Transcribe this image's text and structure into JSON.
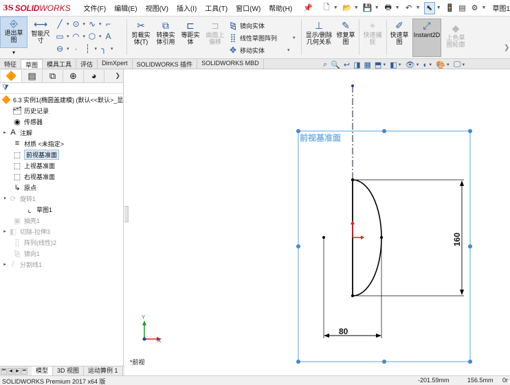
{
  "app": {
    "logo_ds": "3S",
    "logo_solid": "SOLID",
    "logo_works": "WORKS",
    "document_title": "草图1"
  },
  "menu": {
    "items": [
      {
        "label": "文件(F)"
      },
      {
        "label": "编辑(E)"
      },
      {
        "label": "视图(V)"
      },
      {
        "label": "插入(I)"
      },
      {
        "label": "工具(T)"
      },
      {
        "label": "窗口(W)"
      },
      {
        "label": "帮助(H)"
      }
    ]
  },
  "ribbon": {
    "exit_sketch": "退出草图",
    "smart_dim": "智能尺寸",
    "trim": "剪裁实体(T)",
    "convert": "转换实体引用",
    "offset": "等距实体",
    "surface_offset": "曲面上偏移",
    "mirror": "镜向实体",
    "linear_pattern": "线性草图阵列",
    "move": "移动实体",
    "display_delete": "显示/删除几何关系",
    "repair": "修复草图",
    "quick_snaps": "快速捕捉",
    "rapid_sketch": "快速草图",
    "instant2d": "Instant2D",
    "shaded_sketch": "上色草图轮廓"
  },
  "command_tabs": [
    {
      "label": "特征"
    },
    {
      "label": "草图"
    },
    {
      "label": "模具工具"
    },
    {
      "label": "评估"
    },
    {
      "label": "DimXpert"
    },
    {
      "label": "SOLIDWORKS 插件"
    },
    {
      "label": "SOLIDWORKS MBD"
    }
  ],
  "tree": {
    "root": "6.3 实例1(椭圆盖建模)  (默认<<默认>_显",
    "items": [
      {
        "label": "历史记录"
      },
      {
        "label": "传感器"
      },
      {
        "label": "注解"
      },
      {
        "label": "材质 <未指定>"
      },
      {
        "label": "前视基准面"
      },
      {
        "label": "上视基准面"
      },
      {
        "label": "右视基准面"
      },
      {
        "label": "原点"
      },
      {
        "label": "旋转1"
      },
      {
        "label": "草图1"
      },
      {
        "label": "抽壳1"
      },
      {
        "label": "切除-拉伸3"
      },
      {
        "label": "阵列(线性)2"
      },
      {
        "label": "镜向1"
      },
      {
        "label": "分割线1"
      }
    ]
  },
  "bottom_tabs": [
    {
      "label": "模型"
    },
    {
      "label": "3D 视图"
    },
    {
      "label": "运动算例 1"
    }
  ],
  "status": {
    "product": "SOLIDWORKS Premium 2017 x64 版",
    "x": "-201.59mm",
    "y": "156.5mm",
    "z": "0r"
  },
  "graphics": {
    "plane_label": "前视基准面",
    "dim_vertical": "160",
    "dim_horizontal": "80",
    "view_label": "*前视",
    "triad_y": "Y",
    "triad_x": "X"
  },
  "colors": {
    "accent": "#c8102e",
    "plane_border": "#5aa0e6",
    "origin_red": "#e02020"
  }
}
